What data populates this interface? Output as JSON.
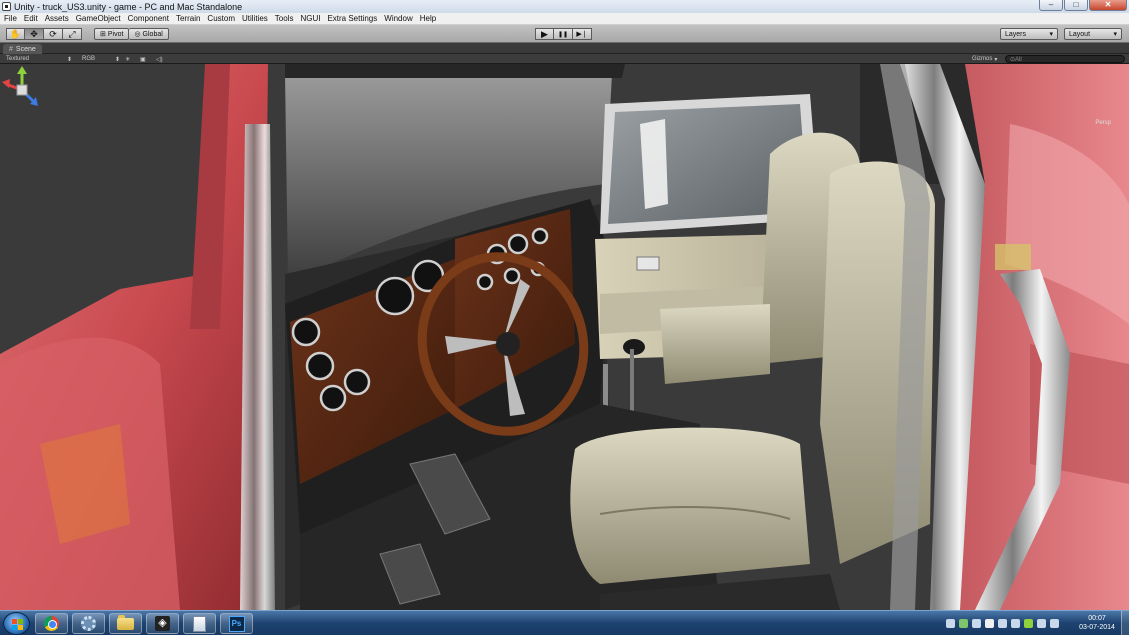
{
  "window": {
    "title": "Unity - truck_US3.unity - game - PC and Mac Standalone",
    "controls": {
      "minimize": "–",
      "maximize": "□",
      "close": "✕"
    }
  },
  "menu": [
    "File",
    "Edit",
    "Assets",
    "GameObject",
    "Component",
    "Terrain",
    "Custom",
    "Utilities",
    "Tools",
    "NGUI",
    "Extra Settings",
    "Window",
    "Help"
  ],
  "toolbar": {
    "tools": [
      "hand-icon",
      "move-icon",
      "rotate-icon",
      "scale-icon"
    ],
    "pivot_label": "Pivot",
    "global_label": "Global",
    "play": "▶",
    "pause": "❚❚",
    "step": "▶❘",
    "layers_label": "Layers",
    "layout_label": "Layout"
  },
  "scene": {
    "tab_label": "Scene",
    "render_mode": "Textured",
    "color_mode": "RGB",
    "gizmos_label": "Gizmos",
    "search_placeholder": "⊙All",
    "persp_label": "Persp"
  },
  "taskbar": {
    "apps": [
      "chrome-icon",
      "settings-icon",
      "folder-icon",
      "unity-icon",
      "document-icon",
      "photoshop-icon"
    ],
    "ps_label": "Ps",
    "unity_label": "◈",
    "time": "00:07",
    "date": "03-07-2014"
  },
  "colors": {
    "truck_body": "#c94a4f",
    "dashboard_wood": "#5a2a14",
    "seat_leather": "#c8c3aa",
    "editor_bg": "#3a3a3a"
  }
}
